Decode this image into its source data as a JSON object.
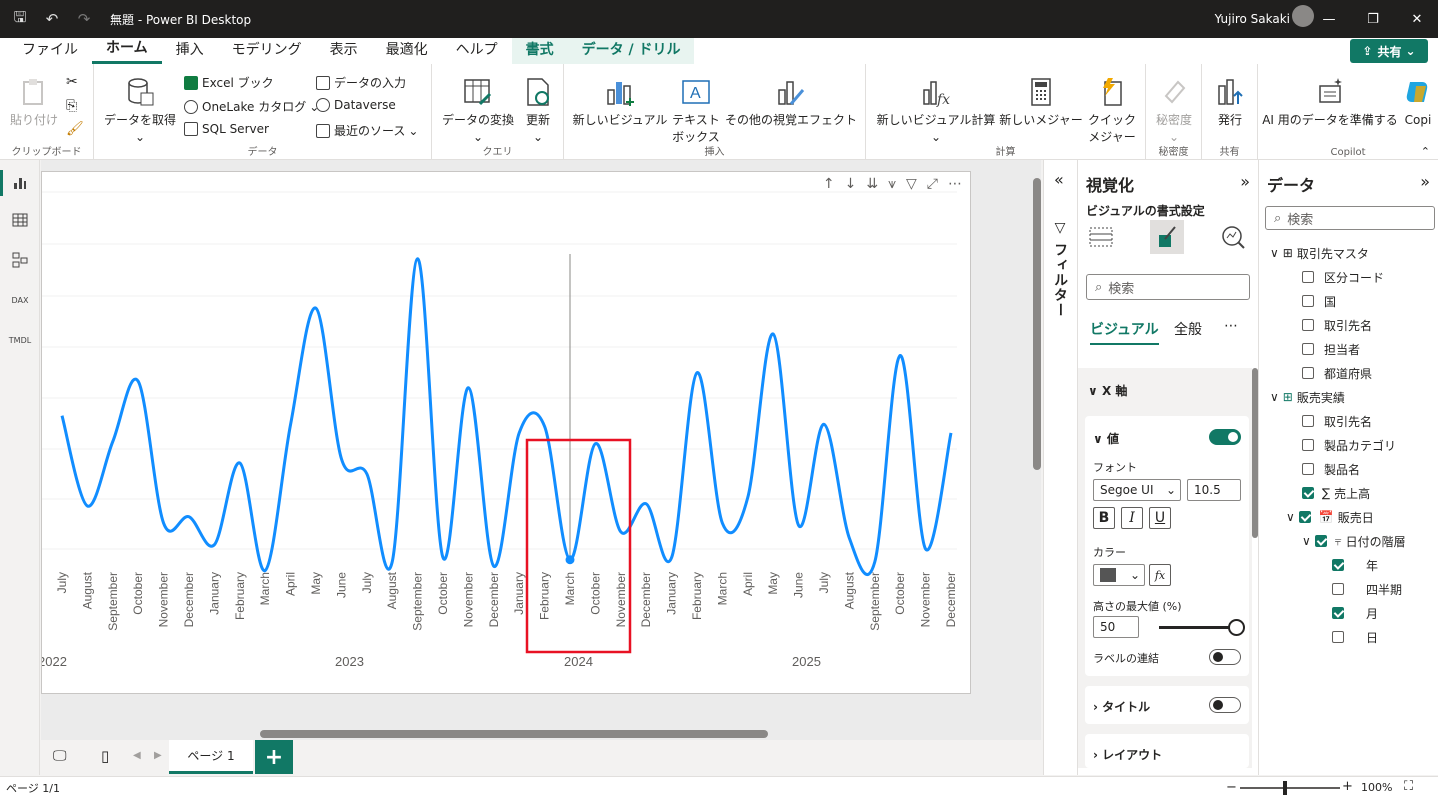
{
  "titlebar": {
    "title": "無題 - Power BI Desktop",
    "user": "Yujiro Sakaki"
  },
  "menu": {
    "items": [
      "ファイル",
      "ホーム",
      "挿入",
      "モデリング",
      "表示",
      "最適化",
      "ヘルプ",
      "書式",
      "データ / ドリル"
    ],
    "share": "共有"
  },
  "ribbon": {
    "clipboard": {
      "paste": "貼り付け",
      "label": "クリップボード"
    },
    "data": {
      "get_data": "データを取得",
      "excel": "Excel ブック",
      "onelake": "OneLake カタログ",
      "sql": "SQL Server",
      "enter": "データの入力",
      "dataverse": "Dataverse",
      "recent": "最近のソース",
      "label": "データ"
    },
    "query": {
      "transform": "データの変換",
      "refresh": "更新",
      "label": "クエリ"
    },
    "insert": {
      "new_visual": "新しいビジュアル",
      "textbox": "テキスト ボックス",
      "more": "その他の視覚エフェクト",
      "label": "挿入"
    },
    "calc": {
      "new_visual_calc": "新しいビジュアル計算",
      "new_measure": "新しいメジャー",
      "quick_measure": "クイック メジャー",
      "label": "計算"
    },
    "sensitivity": {
      "btn": "秘密度",
      "label": "秘密度"
    },
    "share": {
      "publish": "発行",
      "label": "共有"
    },
    "copilot": {
      "ai_prep": "AI 用のデータを準備する",
      "copilot": "Copi",
      "label": "Copilot"
    }
  },
  "chart_data": {
    "type": "line",
    "x": [
      "July",
      "August",
      "September",
      "October",
      "November",
      "December",
      "January",
      "February",
      "March",
      "April",
      "May",
      "June",
      "July",
      "August",
      "September",
      "October",
      "November",
      "December",
      "January",
      "February",
      "March",
      "October",
      "November",
      "December",
      "January",
      "February",
      "March",
      "April",
      "May",
      "June",
      "July",
      "August",
      "September",
      "October",
      "November",
      "December"
    ],
    "years": [
      {
        "label": "2022",
        "index": 0
      },
      {
        "label": "2023",
        "index": 12
      },
      {
        "label": "2024",
        "index": 21
      },
      {
        "label": "2025",
        "index": 30
      }
    ],
    "values": [
      62,
      20,
      50,
      78,
      12,
      15,
      2,
      40,
      -10,
      58,
      112,
      42,
      35,
      -6,
      135,
      -4,
      75,
      -8,
      54,
      57,
      -5,
      49,
      8,
      21,
      -4,
      82,
      12,
      24,
      100,
      11,
      58,
      5,
      -6,
      90,
      0,
      54
    ]
  },
  "visual": {
    "highlight_index": 20
  },
  "filters": {
    "label": "フィルター"
  },
  "viz_pane": {
    "title": "視覚化",
    "subtitle": "ビジュアルの書式設定",
    "search": "検索",
    "tabs": [
      "ビジュアル",
      "全般"
    ],
    "x_axis": "X 軸",
    "values_section": "値",
    "font_label": "フォント",
    "font_family": "Segoe UI",
    "font_size": "10.5",
    "color_label": "カラー",
    "max_height_label": "高さの最大値 (%)",
    "max_height": "50",
    "concat_label": "ラベルの連結",
    "title_section": "タイトル",
    "layout_section": "レイアウト"
  },
  "data_pane": {
    "title": "データ",
    "search": "検索",
    "tables": [
      {
        "name": "取引先マスタ",
        "fields": [
          {
            "name": "区分コード",
            "checked": false
          },
          {
            "name": "国",
            "checked": false
          },
          {
            "name": "取引先名",
            "checked": false
          },
          {
            "name": "担当者",
            "checked": false
          },
          {
            "name": "都道府県",
            "checked": false
          }
        ]
      },
      {
        "name": "販売実績",
        "fields": [
          {
            "name": "取引先名",
            "checked": false
          },
          {
            "name": "製品カテゴリ",
            "checked": false
          },
          {
            "name": "製品名",
            "checked": false
          },
          {
            "name": "売上高",
            "checked": true
          }
        ]
      }
    ],
    "date_field": "販売日",
    "hierarchy": "日付の階層",
    "levels": [
      {
        "name": "年",
        "checked": true
      },
      {
        "name": "四半期",
        "checked": false
      },
      {
        "name": "月",
        "checked": true
      },
      {
        "name": "日",
        "checked": false
      }
    ]
  },
  "pagebar": {
    "page": "ページ 1"
  },
  "status": {
    "page": "ページ 1/1",
    "zoom": "100%"
  },
  "colors": {
    "accent": "#117865",
    "line": "#118dff",
    "highlight": "#e81123"
  }
}
